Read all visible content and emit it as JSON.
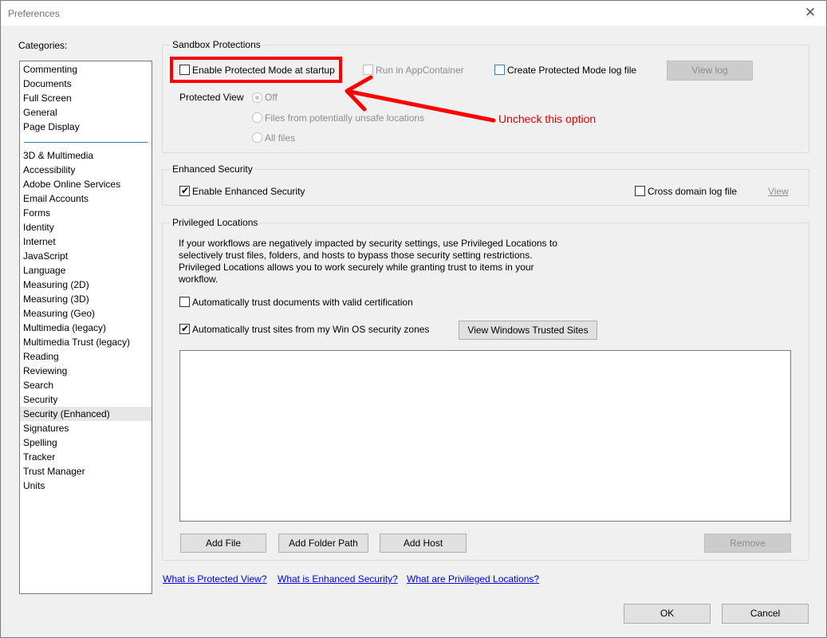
{
  "window": {
    "title": "Preferences",
    "close_icon": "✕"
  },
  "categories": {
    "label": "Categories:",
    "group1": [
      "Commenting",
      "Documents",
      "Full Screen",
      "General",
      "Page Display"
    ],
    "group2": [
      "3D & Multimedia",
      "Accessibility",
      "Adobe Online Services",
      "Email Accounts",
      "Forms",
      "Identity",
      "Internet",
      "JavaScript",
      "Language",
      "Measuring (2D)",
      "Measuring (3D)",
      "Measuring (Geo)",
      "Multimedia (legacy)",
      "Multimedia Trust (legacy)",
      "Reading",
      "Reviewing",
      "Search",
      "Security",
      "Security (Enhanced)",
      "Signatures",
      "Spelling",
      "Tracker",
      "Trust Manager",
      "Units"
    ],
    "selected": "Security (Enhanced)"
  },
  "sandbox": {
    "title": "Sandbox Protections",
    "enable_protected_mode": "Enable Protected Mode at startup",
    "run_in_appcontainer": "Run in AppContainer",
    "create_log": "Create Protected Mode log file",
    "view_log": "View log",
    "protected_view_label": "Protected View",
    "radio_options": [
      "Off",
      "Files from potentially unsafe locations",
      "All files"
    ]
  },
  "enhanced": {
    "title": "Enhanced Security",
    "enable": "Enable Enhanced Security",
    "cross_domain": "Cross domain log file",
    "view": "View"
  },
  "privileged": {
    "title": "Privileged Locations",
    "description": "If your workflows are negatively impacted by security settings, use Privileged Locations to selectively trust files, folders, and hosts to bypass those security setting restrictions. Privileged Locations allows you to work securely while granting trust to items in your workflow.",
    "trust_cert": "Automatically trust documents with valid certification",
    "trust_sites": "Automatically trust sites from my Win OS security zones",
    "view_trusted": "View Windows Trusted Sites",
    "add_file": "Add File",
    "add_folder": "Add Folder Path",
    "add_host": "Add Host",
    "remove": "Remove"
  },
  "links": {
    "protected_view": "What is Protected View?",
    "enhanced_security": "What is Enhanced Security?",
    "privileged_locations": "What are Privileged Locations?"
  },
  "footer": {
    "ok": "OK",
    "cancel": "Cancel"
  },
  "annotation": {
    "text": "Uncheck this option",
    "color": "#ff0000"
  },
  "checkmark": "✔"
}
